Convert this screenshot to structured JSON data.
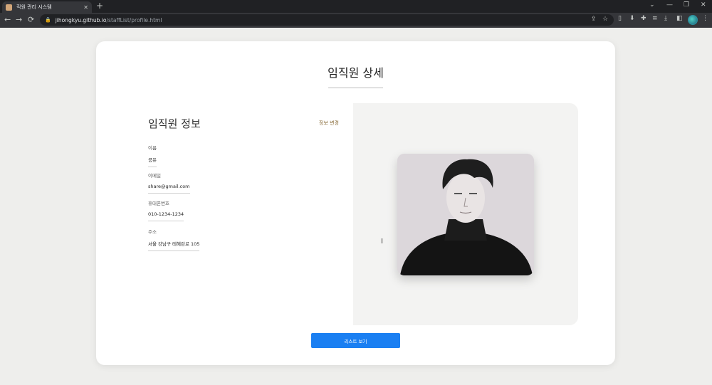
{
  "browser": {
    "tab_title": "직원 관리 시스템",
    "tab_close": "✕",
    "new_tab": "+",
    "url_host": "jihongkyu.github.io",
    "url_path": "/staffList/profile.html",
    "win_minimize": "—",
    "win_maximize": "❐",
    "win_close": "✕",
    "tab_list": "⌄",
    "back": "←",
    "forward": "→",
    "reload": "⟳",
    "menu": "⋮"
  },
  "page": {
    "title": "임직원 상세",
    "section_title": "임직원 정보",
    "edit_label": "정보 변경",
    "fields": [
      {
        "label": "이름",
        "value": "공유"
      },
      {
        "label": "이메일",
        "value": "share@gmail.com"
      },
      {
        "label": "휴대폰번호",
        "value": "010-1234-1234"
      },
      {
        "label": "주소",
        "value": "서울 강남구 테헤란로 105"
      }
    ],
    "list_button": "리스트 보기"
  },
  "colors": {
    "accent": "#1a7ff2",
    "page_bg": "#eeeeec",
    "chrome_dark": "#202124",
    "chrome": "#35363a",
    "edit_link": "#8a6d3b"
  }
}
